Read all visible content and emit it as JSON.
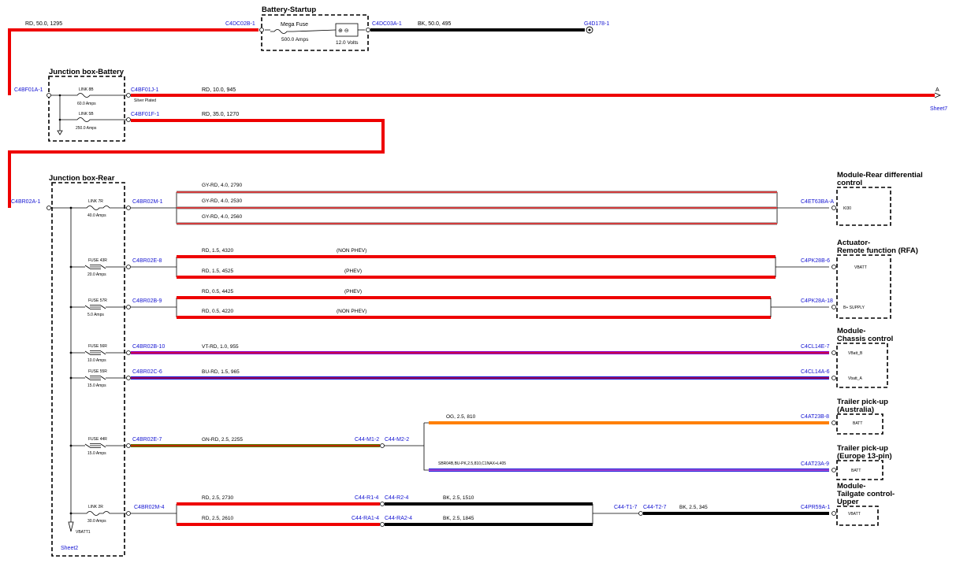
{
  "colors": {
    "red": "#ee0000",
    "black": "#000000",
    "gray": "#a0a0a0",
    "violet": "#8b00c8",
    "blue": "#1818d8",
    "orange": "#ff7f00",
    "green": "#5a7800",
    "label_blue": "#1414d2"
  },
  "blocks": {
    "battery_startup": {
      "title": "Battery-Startup",
      "fuse_name": "Mega Fuse",
      "fuse_rating": "500.0 Amps",
      "battery_voltage": "12.0 Volts",
      "battery_symbol": "⊕ ⊖"
    },
    "jb_battery": {
      "title": "Junction box-Battery",
      "link1_name": "LINK 8B",
      "link1_rating": "60.0 Amps",
      "link2_name": "LINK 5B",
      "link2_rating": "250.0 Amps",
      "silver_plated": "Silver Plated"
    },
    "jb_rear": {
      "title": "Junction box-Rear",
      "sheet": "Sheet2",
      "vbatt": "VBATT1",
      "fuses": [
        {
          "name": "LINK 7R",
          "rating": "40.0 Amps"
        },
        {
          "name": "FUSE 43R",
          "rating": "20.0 Amps"
        },
        {
          "name": "FUSE 57R",
          "rating": "5.0 Amps"
        },
        {
          "name": "FUSE 56R",
          "rating": "10.0 Amps"
        },
        {
          "name": "FUSE 55R",
          "rating": "15.0 Amps"
        },
        {
          "name": "FUSE 44R",
          "rating": "15.0 Amps"
        },
        {
          "name": "LINK 2R",
          "rating": "30.0 Amps"
        }
      ]
    },
    "modules": [
      {
        "title1": "Module-Rear differential",
        "title2": "control",
        "pins": [
          "Kl30"
        ]
      },
      {
        "title1": "Actuator-",
        "title2": "Remote function (RFA)",
        "pins": [
          "VBATT",
          "B+ SUPPLY"
        ]
      },
      {
        "title1": "Module-",
        "title2": "Chassis control",
        "pins": [
          "VBatt_B",
          "Vbatt_A"
        ]
      },
      {
        "title1": "Trailer pick-up",
        "title2": "(Australia)",
        "pins": [
          "BATT"
        ]
      },
      {
        "title1": "Trailer pick-up",
        "title2": "(Europe 13-pin)",
        "pins": [
          "BATT"
        ]
      },
      {
        "title1": "Module-",
        "title2": "Tailgate control-",
        "title3": "Upper",
        "pins": [
          "VBATT"
        ]
      }
    ]
  },
  "connectors": {
    "c4dc02b": "C4DC02B-1",
    "c4dc03a": "C4DC03A-1",
    "g4d178": "G4D178-1",
    "c4bf01a": "C4BF01A-1",
    "c4bf01j": "C4BF01J-1",
    "c4bf01f": "C4BF01F-1",
    "c4br02a": "C4BR02A-1",
    "c4br02m1": "C4BR02M-1",
    "c4br02e8": "C4BR02E-8",
    "c4br02b9": "C4BR02B-9",
    "c4br02b10": "C4BR02B-10",
    "c4br02c6": "C4BR02C-6",
    "c4br02e7": "C4BR02E-7",
    "c4br02m4": "C4BR02M-4",
    "c4et63ba": "C4ET63BA-A",
    "c4pk28b": "C4PK28B-6",
    "c4pk28a": "C4PK28A-18",
    "c4cl14e": "C4CL14E-7",
    "c4cl14a": "C4CL14A-6",
    "c44m1": "C44-M1-2",
    "c44m2": "C44-M2-2",
    "c4at23b": "C4AT23B-8",
    "c4at23a": "C4AT23A-9",
    "c44r1": "C44-R1-4",
    "c44r2": "C44-R2-4",
    "c44ra1": "C44-RA1-4",
    "c44ra2": "C44-RA2-4",
    "c44t1": "C44-T1-7",
    "c44t2": "C44-T2-7",
    "c4pr59a": "C4PR59A-1"
  },
  "wires": {
    "w1295": "RD,  50.0,  1295",
    "w495": "BK,  50.0,  495",
    "w945": "RD,  10.0,  945",
    "w1270": "RD,  35.0,  1270",
    "w2790": "GY-RD,  4.0,  2790",
    "w2530": "GY-RD,  4.0,  2530",
    "w2560": "GY-RD,  4.0,  2560",
    "w4320": "RD,  1.5,  4320",
    "w4525": "RD,  1.5,  4525",
    "w4425": "RD,  0.5,  4425",
    "w4220": "RD,  0.5,  4220",
    "w955": "VT-RD,  1.0,  955",
    "w965": "BU-RD,  1.5,  965",
    "w2255": "GN-RD,  2.5,  2255",
    "w810": "OG,  2.5,  810",
    "wsbr": "SBR04B,BU-PK,2.5,810,C1NAX+L405",
    "w2730": "RD,  2.5,  2730",
    "w2610": "RD,  2.5,  2610",
    "w1510": "BK,  2.5,  1510",
    "w1845": "BK,  2.5,  1845",
    "w345": "BK,  2.5,  345"
  },
  "notes": {
    "non_phev": "(NON PHEV)",
    "phev": "(PHEV)",
    "offpage_letter": "A",
    "offpage_sheet": "Sheet7"
  }
}
